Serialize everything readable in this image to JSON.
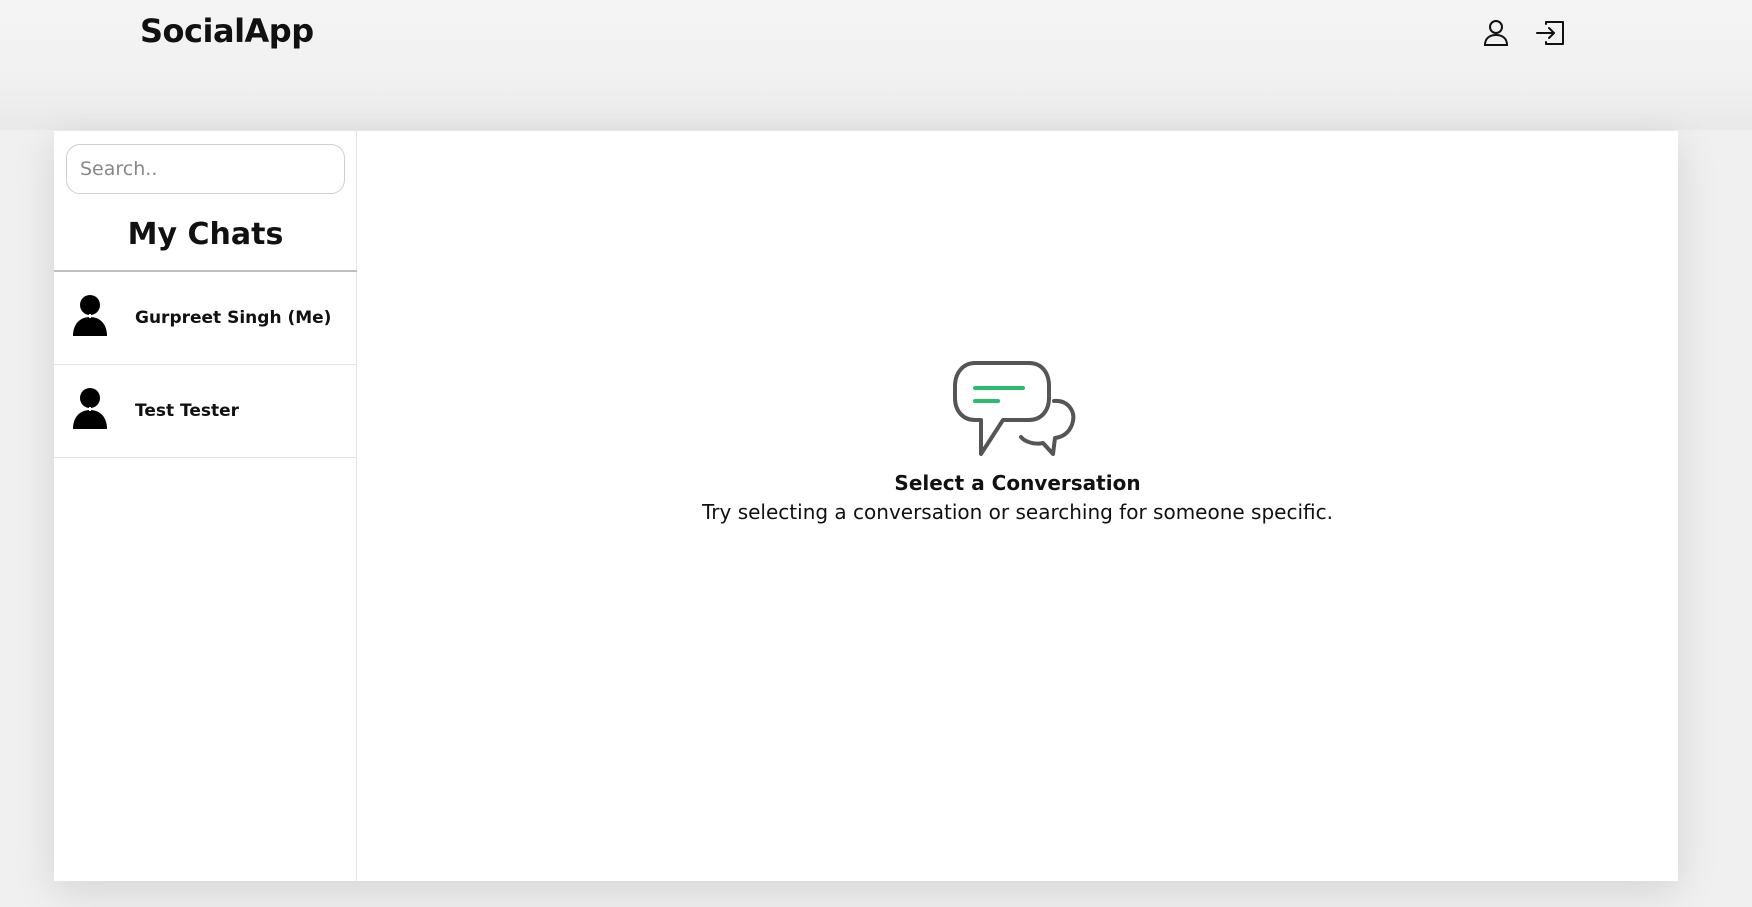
{
  "header": {
    "brand": "SocialApp",
    "icons": [
      "user-profile-icon",
      "logout-icon"
    ]
  },
  "sidebar": {
    "search": {
      "placeholder": "Search..",
      "value": ""
    },
    "title": "My Chats",
    "chats": [
      {
        "name": "Gurpreet Singh (Me)",
        "icon": "avatar-icon"
      },
      {
        "name": "Test Tester",
        "icon": "avatar-icon"
      }
    ]
  },
  "main": {
    "empty_state": {
      "icon": "chat-bubbles-icon",
      "accent_color": "#2bbd6e",
      "title": "Select a Conversation",
      "subtitle": "Try selecting a conversation or searching for someone specific."
    }
  }
}
